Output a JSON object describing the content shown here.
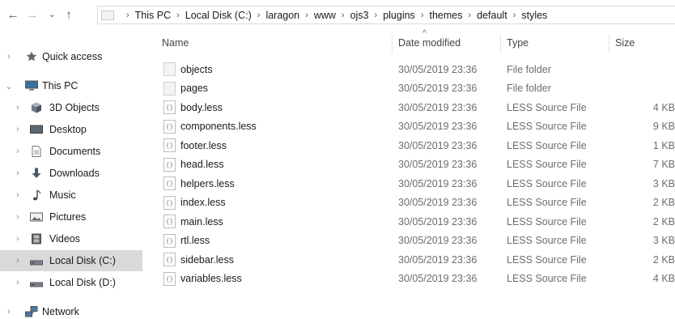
{
  "nav": {
    "back_glyph": "←",
    "forward_glyph": "→",
    "recent_glyph": "⌄",
    "up_glyph": "↑"
  },
  "breadcrumb": [
    "This PC",
    "Local Disk (C:)",
    "laragon",
    "www",
    "ojs3",
    "plugins",
    "themes",
    "default",
    "styles"
  ],
  "sidebar": {
    "items": [
      {
        "label": "Quick access",
        "icon": "star-icon",
        "chevron": "›"
      },
      {
        "label": "This PC",
        "icon": "computer-icon",
        "chevron": "⌄"
      },
      {
        "label": "3D Objects",
        "icon": "cube-icon",
        "chevron": "›"
      },
      {
        "label": "Desktop",
        "icon": "desktop-icon",
        "chevron": "›"
      },
      {
        "label": "Documents",
        "icon": "document-icon",
        "chevron": "›"
      },
      {
        "label": "Downloads",
        "icon": "download-icon",
        "chevron": "›"
      },
      {
        "label": "Music",
        "icon": "music-icon",
        "chevron": "›"
      },
      {
        "label": "Pictures",
        "icon": "pictures-icon",
        "chevron": "›"
      },
      {
        "label": "Videos",
        "icon": "video-icon",
        "chevron": "›"
      },
      {
        "label": "Local Disk (C:)",
        "icon": "drive-icon",
        "chevron": "›",
        "selected": true
      },
      {
        "label": "Local Disk (D:)",
        "icon": "drive-icon",
        "chevron": "›"
      },
      {
        "label": "Network",
        "icon": "network-icon",
        "chevron": "›"
      }
    ]
  },
  "columns": {
    "name": "Name",
    "date": "Date modified",
    "type": "Type",
    "size": "Size",
    "sort_glyph": "^"
  },
  "files": [
    {
      "name": "objects",
      "date": "30/05/2019 23:36",
      "type": "File folder",
      "size": "",
      "kind": "folder"
    },
    {
      "name": "pages",
      "date": "30/05/2019 23:36",
      "type": "File folder",
      "size": "",
      "kind": "folder"
    },
    {
      "name": "body.less",
      "date": "30/05/2019 23:36",
      "type": "LESS Source File",
      "size": "4 KB",
      "kind": "file"
    },
    {
      "name": "components.less",
      "date": "30/05/2019 23:36",
      "type": "LESS Source File",
      "size": "9 KB",
      "kind": "file"
    },
    {
      "name": "footer.less",
      "date": "30/05/2019 23:36",
      "type": "LESS Source File",
      "size": "1 KB",
      "kind": "file"
    },
    {
      "name": "head.less",
      "date": "30/05/2019 23:36",
      "type": "LESS Source File",
      "size": "7 KB",
      "kind": "file"
    },
    {
      "name": "helpers.less",
      "date": "30/05/2019 23:36",
      "type": "LESS Source File",
      "size": "3 KB",
      "kind": "file"
    },
    {
      "name": "index.less",
      "date": "30/05/2019 23:36",
      "type": "LESS Source File",
      "size": "2 KB",
      "kind": "file"
    },
    {
      "name": "main.less",
      "date": "30/05/2019 23:36",
      "type": "LESS Source File",
      "size": "2 KB",
      "kind": "file"
    },
    {
      "name": "rtl.less",
      "date": "30/05/2019 23:36",
      "type": "LESS Source File",
      "size": "3 KB",
      "kind": "file"
    },
    {
      "name": "sidebar.less",
      "date": "30/05/2019 23:36",
      "type": "LESS Source File",
      "size": "2 KB",
      "kind": "file"
    },
    {
      "name": "variables.less",
      "date": "30/05/2019 23:36",
      "type": "LESS Source File",
      "size": "4 KB",
      "kind": "file"
    }
  ],
  "colors": {
    "selected_bg": "#d9d9d9",
    "muted_text": "#6d6d6d"
  }
}
